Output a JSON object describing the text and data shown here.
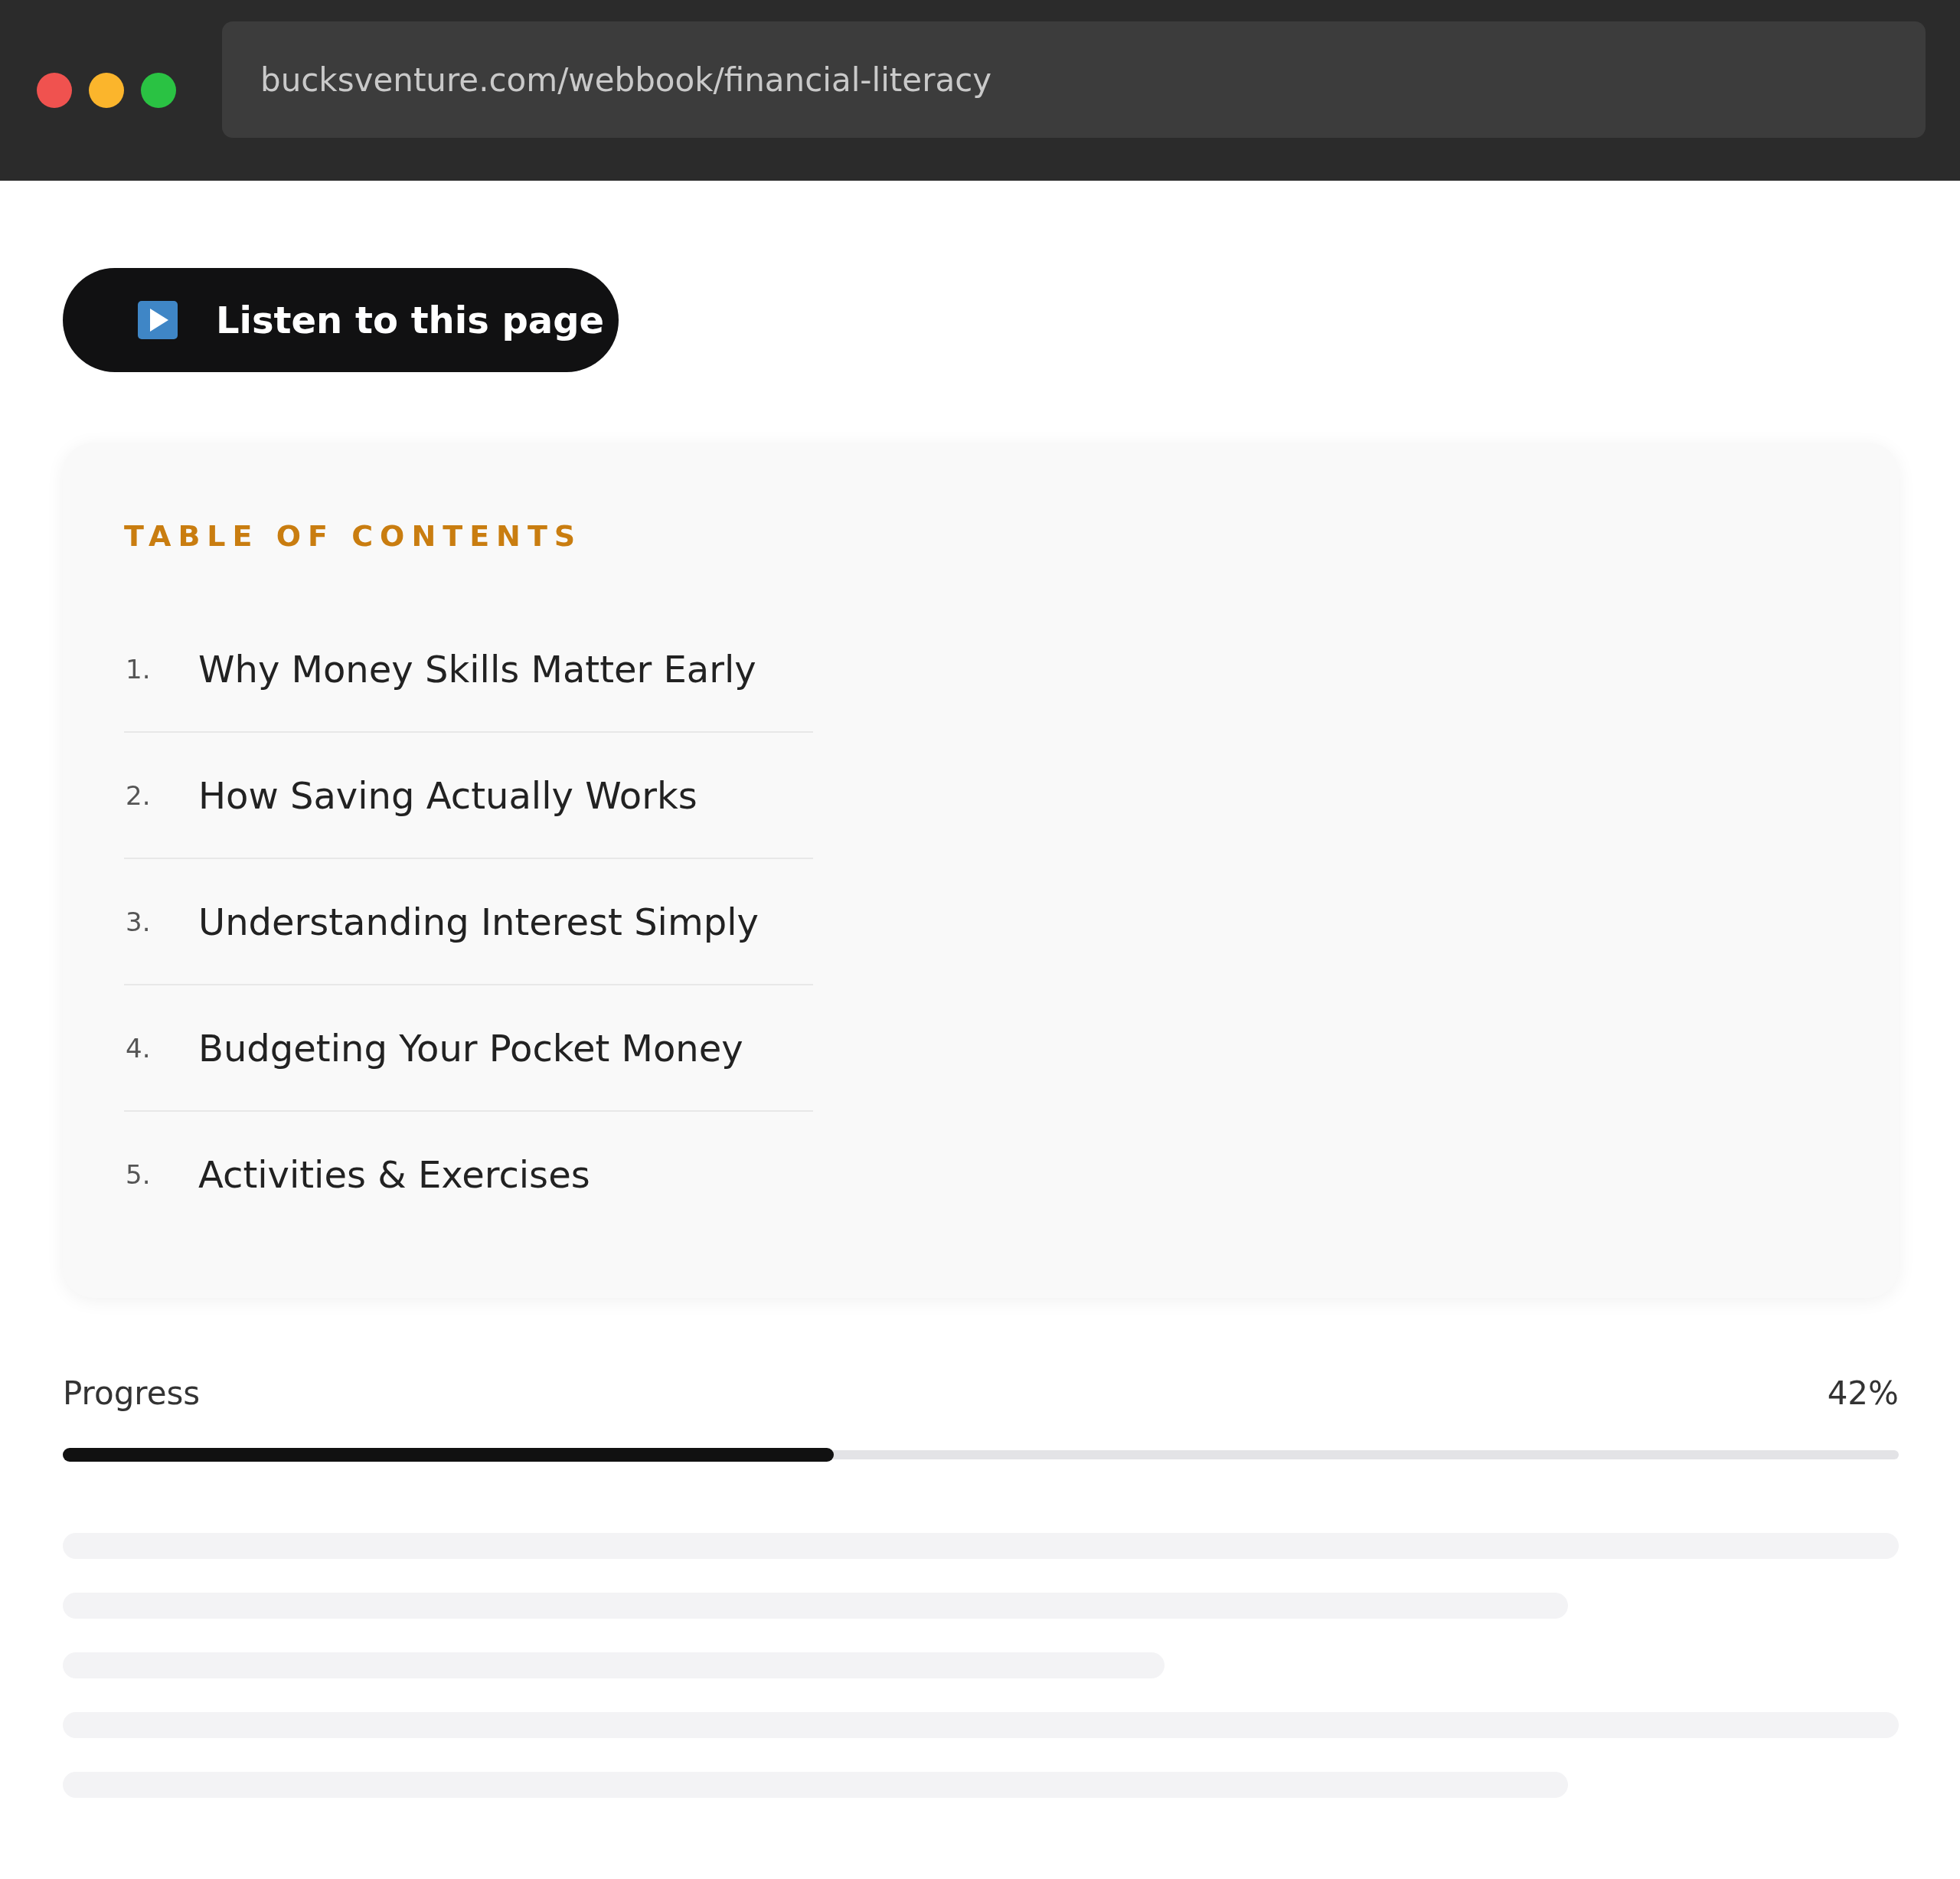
{
  "browser": {
    "url": "bucksventure.com/webbook/financial-literacy"
  },
  "listen_button": {
    "label": "Listen to this page"
  },
  "table_of_contents": {
    "title": "TABLE OF CONTENTS",
    "items": [
      {
        "number": "1.",
        "title": "Why Money Skills Matter Early"
      },
      {
        "number": "2.",
        "title": "How Saving Actually Works"
      },
      {
        "number": "3.",
        "title": "Understanding Interest Simply"
      },
      {
        "number": "4.",
        "title": "Budgeting Your Pocket Money"
      },
      {
        "number": "5.",
        "title": "Activities & Exercises"
      }
    ]
  },
  "progress": {
    "label": "Progress",
    "reading": "42%",
    "level": 0.42
  }
}
